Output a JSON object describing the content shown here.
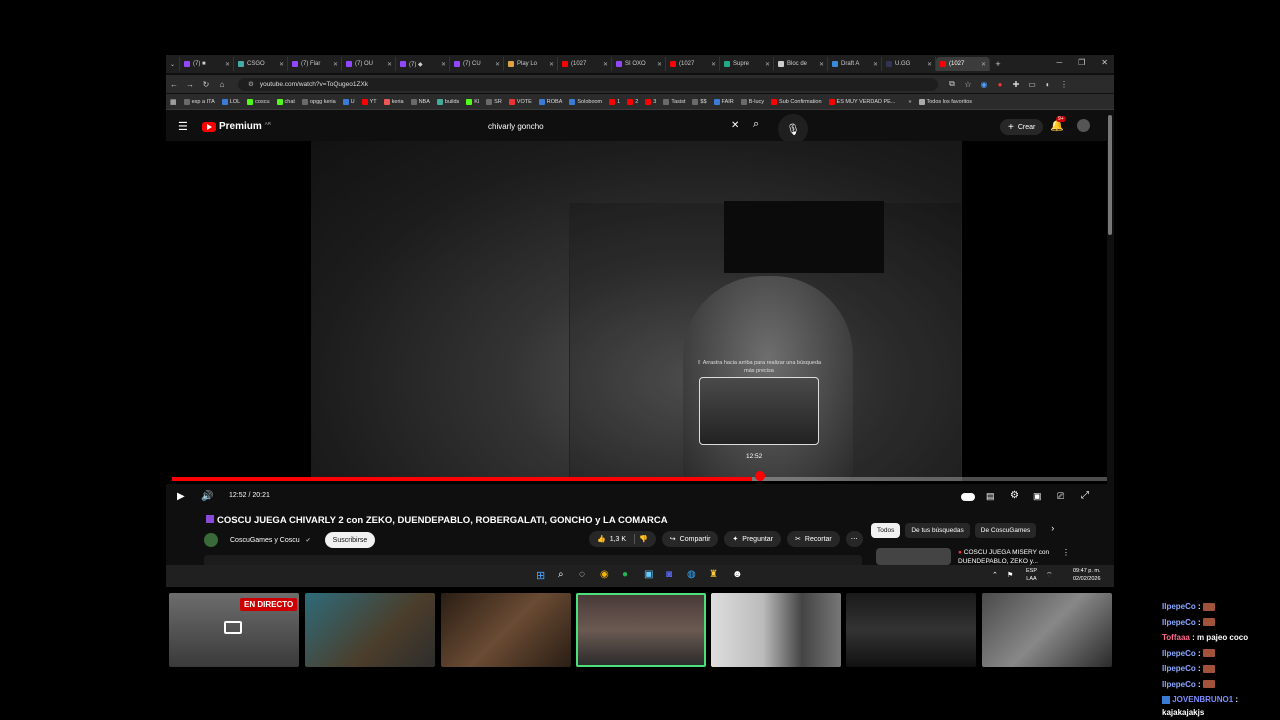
{
  "browser": {
    "tabs": [
      {
        "label": "(7) ■"
      },
      {
        "label": "CSGO"
      },
      {
        "label": "(7) Flar"
      },
      {
        "label": "(7) OU"
      },
      {
        "label": "(7) ◆"
      },
      {
        "label": "(7) CU"
      },
      {
        "label": "Play Lo"
      },
      {
        "label": "(1027"
      },
      {
        "label": "SI OXO"
      },
      {
        "label": "(1027"
      },
      {
        "label": "Supre"
      },
      {
        "label": "Bloc de"
      },
      {
        "label": "Draft A"
      },
      {
        "label": "U.GG"
      },
      {
        "label": "(1027"
      }
    ],
    "url": "youtube.com/watch?v=ToQugeo1ZXk",
    "bookmarks": [
      "esp a ITA",
      "LOL",
      "coscu",
      "chat",
      "opgg keria",
      "U",
      "YT",
      "keria",
      "NBA",
      "builds",
      "Kl",
      "SR",
      "VOTE",
      "ROBA",
      "Soloboom",
      "1",
      "2",
      "3",
      "Tasist",
      "$$",
      "FAIR",
      "B-lucy",
      "Sub Confirmation",
      "ES MUY VERDAD PE..."
    ],
    "all_bookmarks": "Todos los favoritos"
  },
  "youtube": {
    "logo": "Premium",
    "logo_badge": "AR",
    "search_value": "chivarly goncho",
    "create_label": "Crear",
    "notif_count": "9+",
    "preview_hint": "⇧ Arrastra hacia arriba para realizar una búsqueda más precisa",
    "preview_time": "12:52",
    "time_display": "12:52 / 20:21",
    "progress": 0.62,
    "video_title": "COSCU JUEGA CHIVARLY 2 con ZEKO, DUENDEPABLO, ROBERGALATI, GONCHO y LA COMARCA",
    "channel": "CoscuGames y Coscu",
    "subscribe": "Suscribirse",
    "likes": "1,3 K",
    "share": "Compartir",
    "ask": "Preguntar",
    "clip": "Recortar",
    "filters": [
      "Todos",
      "De tus búsquedas",
      "De CoscuGames"
    ],
    "suggested_title": "COSCU JUEGA MISERY con DUENDEPABLO, ZEKO y..."
  },
  "taskbar": {
    "lang": "ESP",
    "lang2": "LAA",
    "time": "09:47 p. m.",
    "date": "02/02/2026"
  },
  "stream": {
    "live_badge": "EN DIRECTO"
  },
  "chat": [
    {
      "user": "IlpepeCo",
      "color": "#8aa7ff",
      "text": ""
    },
    {
      "user": "IlpepeCo",
      "color": "#8aa7ff",
      "text": ""
    },
    {
      "user": "Toffaaa",
      "color": "#ff6a8d",
      "text": "m pajeo coco"
    },
    {
      "user": "IlpepeCo",
      "color": "#8aa7ff",
      "text": ""
    },
    {
      "user": "IlpepeCo",
      "color": "#8aa7ff",
      "text": ""
    },
    {
      "user": "IlpepeCo",
      "color": "#8aa7ff",
      "text": ""
    },
    {
      "user": "JOVENBRUNO1",
      "color": "#7b8cff",
      "text": "kajakajakjs"
    }
  ]
}
